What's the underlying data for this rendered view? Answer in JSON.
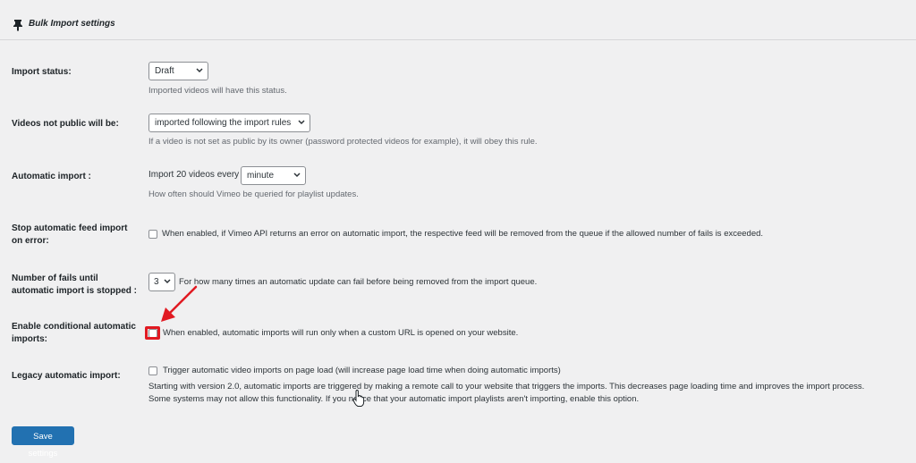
{
  "header": {
    "title": "Bulk Import settings",
    "icon": "pin-icon"
  },
  "import_status": {
    "label": "Import status:",
    "value": "Draft",
    "description": "Imported videos will have this status."
  },
  "not_public": {
    "label": "Videos not public will be:",
    "value": "imported following the import rules",
    "description": "If a video is not set as public by its owner (password protected videos for example), it will obey this rule."
  },
  "automatic_import": {
    "label": "Automatic import :",
    "prefix": "Import 20 videos every",
    "value": "minute",
    "description": "How often should Vimeo be queried for playlist updates."
  },
  "stop_on_error": {
    "label_line1": "Stop automatic feed import",
    "label_line2": "on error:",
    "checked": false,
    "text": "When enabled, if Vimeo API returns an error on automatic import, the respective feed will be removed from the queue if the allowed number of fails is exceeded."
  },
  "fails": {
    "label_line1": "Number of fails until",
    "label_line2": "automatic import is stopped :",
    "value": "3",
    "text": "For how many times an automatic update can fail before being removed from the import queue."
  },
  "conditional": {
    "label_line1": "Enable conditional automatic",
    "label_line2": "imports:",
    "checked": false,
    "text": "When enabled, automatic imports will run only when a custom URL is opened on your website."
  },
  "legacy": {
    "label": "Legacy automatic import:",
    "checked": false,
    "text": "Trigger automatic video imports on page load (will increase page load time when doing automatic imports)",
    "desc_line1": "Starting with version 2.0, automatic imports are triggered by making a remote call to your website that triggers the imports. This decreases page loading time and improves the import process.",
    "desc_line2": "Some systems may not allow this functionality. If you notice that your automatic import playlists aren't importing, enable this option."
  },
  "save_label": "Save settings",
  "colors": {
    "accent": "#2271b1",
    "highlight": "#e11a22",
    "background": "#f0f0f1"
  }
}
